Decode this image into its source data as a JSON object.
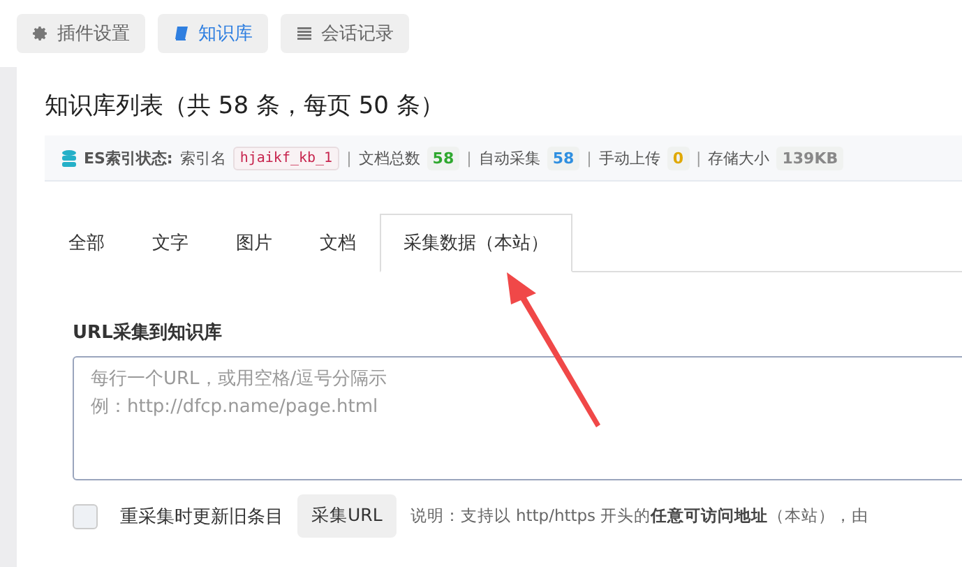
{
  "top_tabs": [
    {
      "label": "插件设置",
      "selected": false
    },
    {
      "label": "知识库",
      "selected": true
    },
    {
      "label": "会话记录",
      "selected": false
    }
  ],
  "title": "知识库列表（共 58 条，每页 50 条）",
  "es_status": {
    "label": "ES索引状态:",
    "index_label": "索引名",
    "index_name": "hjaikf_kb_1",
    "stats": [
      {
        "separator": "|",
        "label": "文档总数",
        "value": "58",
        "color": "#2fa82f"
      },
      {
        "separator": "|",
        "label": "自动采集",
        "value": "58",
        "color": "#2f8fe0"
      },
      {
        "separator": "|",
        "label": "手动上传",
        "value": "0",
        "color": "#e0a800"
      },
      {
        "separator": "|",
        "label": "存储大小",
        "value": "139KB",
        "color": "#888888"
      }
    ]
  },
  "tabs": [
    {
      "label": "全部",
      "selected": false
    },
    {
      "label": "文字",
      "selected": false
    },
    {
      "label": "图片",
      "selected": false
    },
    {
      "label": "文档",
      "selected": false
    },
    {
      "label": "采集数据（本站）",
      "selected": true
    }
  ],
  "form": {
    "label": "URL采集到知识库",
    "placeholder": "每行一个URL，或用空格/逗号分隔示例：http://dfcp.name/page.html",
    "recollect": {
      "label": "重采集时更新旧条目",
      "checked": false
    },
    "button": "采集URL",
    "note": "说明：支持以 http/https 开头的**任意可访问地址**（本站），由"
  }
}
